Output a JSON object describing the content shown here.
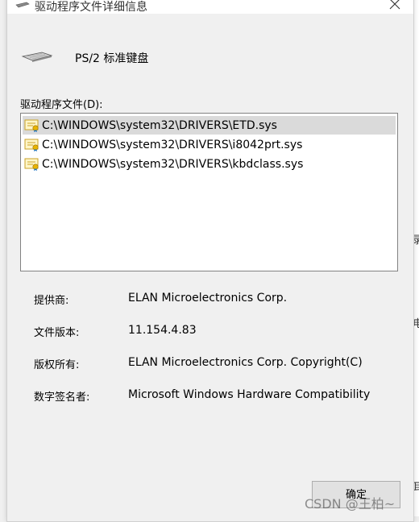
{
  "window": {
    "title": "驱动程序文件详细信息",
    "close_icon": "close-icon"
  },
  "device": {
    "icon": "keyboard-icon",
    "name": "PS/2 标准键盘"
  },
  "files": {
    "label": "驱动程序文件(D):",
    "items": [
      "C:\\WINDOWS\\system32\\DRIVERS\\ETD.sys",
      "C:\\WINDOWS\\system32\\DRIVERS\\i8042prt.sys",
      "C:\\WINDOWS\\system32\\DRIVERS\\kbdclass.sys"
    ],
    "selected_index": 0,
    "item_icon": "certificate-file-icon"
  },
  "properties": [
    {
      "label": "提供商:",
      "value": "ELAN Microelectronics Corp."
    },
    {
      "label": "文件版本:",
      "value": "11.154.4.83"
    },
    {
      "label": "版权所有:",
      "value": "ELAN Microelectronics Corp. Copyright(C)"
    },
    {
      "label": "数字签名者:",
      "value": "Microsoft Windows Hardware Compatibility"
    }
  ],
  "buttons": {
    "ok_label": "确定"
  },
  "background_edge": {
    "glyphs": [
      "录",
      "电",
      "耳"
    ]
  },
  "watermark": "CSDN @王柏~"
}
